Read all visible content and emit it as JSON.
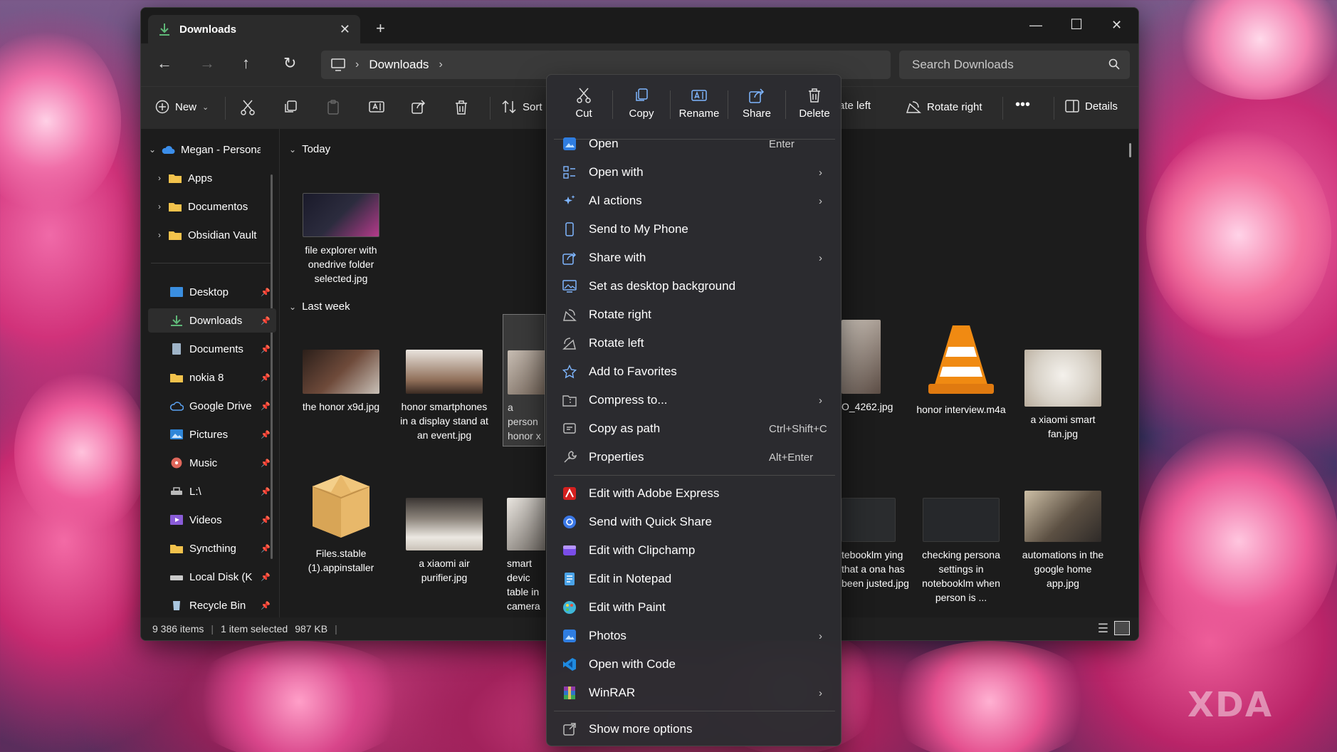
{
  "window": {
    "tab_title": "Downloads",
    "breadcrumb": [
      "Downloads"
    ],
    "search_placeholder": "Search Downloads"
  },
  "toolbar": {
    "new_label": "New",
    "sort_label": "Sort",
    "rotate_left_partial": "ate left",
    "rotate_right_label": "Rotate right",
    "details_label": "Details"
  },
  "sidebar": {
    "account": "Megan - Persona",
    "folders": [
      "Apps",
      "Documentos",
      "Obsidian Vault"
    ],
    "quick_access": [
      "Desktop",
      "Downloads",
      "Documents",
      "nokia 8",
      "Google Drive",
      "Pictures",
      "Music",
      "L:\\",
      "Videos",
      "Syncthing",
      "Local Disk (K",
      "Recycle Bin"
    ]
  },
  "groups": {
    "today": "Today",
    "last_week": "Last week"
  },
  "files": {
    "today": [
      "file explorer with onedrive folder selected.jpg"
    ],
    "row1": [
      "the honor x9d.jpg",
      "honor smartphones in a display stand at an event.jpg",
      "a person honor x display",
      "O_4262.jpg",
      "honor interview.m4a",
      "a xiaomi smart fan.jpg"
    ],
    "row2": [
      "Files.stable (1).appinstaller",
      "a xiaomi air purifier.jpg",
      "smart devic table in camera",
      "tebooklm ying that a ona has been justed.jpg",
      "checking persona settings in notebooklm when person is ...",
      "automations in the google home app.jpg"
    ]
  },
  "status": {
    "items": "9 386 items",
    "selected": "1 item selected",
    "size": "987 KB"
  },
  "context_menu": {
    "quick_actions": [
      "Cut",
      "Copy",
      "Rename",
      "Share",
      "Delete"
    ],
    "items": [
      {
        "label": "Open",
        "shortcut": "Enter"
      },
      {
        "label": "Open with",
        "submenu": true
      },
      {
        "label": "AI actions",
        "submenu": true
      },
      {
        "label": "Send to My Phone"
      },
      {
        "label": "Share with",
        "submenu": true
      },
      {
        "label": "Set as desktop background"
      },
      {
        "label": "Rotate right"
      },
      {
        "label": "Rotate left"
      },
      {
        "label": "Add to Favorites"
      },
      {
        "label": "Compress to...",
        "submenu": true
      },
      {
        "label": "Copy as path",
        "shortcut": "Ctrl+Shift+C"
      },
      {
        "label": "Properties",
        "shortcut": "Alt+Enter"
      }
    ],
    "apps": [
      {
        "label": "Edit with Adobe Express"
      },
      {
        "label": "Send with Quick Share"
      },
      {
        "label": "Edit with Clipchamp"
      },
      {
        "label": "Edit in Notepad"
      },
      {
        "label": "Edit with Paint"
      },
      {
        "label": "Photos",
        "submenu": true
      },
      {
        "label": "Open with Code"
      },
      {
        "label": "WinRAR",
        "submenu": true
      }
    ],
    "more": "Show more options"
  },
  "watermark": "XDA"
}
